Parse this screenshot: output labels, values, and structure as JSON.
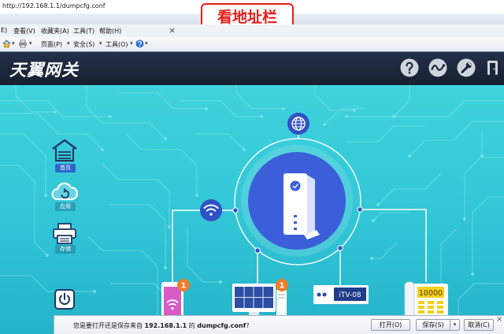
{
  "address_bar": {
    "url": "http://192.168.1.1/dumpcfg.conf"
  },
  "annotation": {
    "text": "看地址栏",
    "color": "#e3201b"
  },
  "menu_bar": {
    "items": [
      "E)",
      "查看(V)",
      "收藏夹(A)",
      "工具(T)",
      "帮助(H)"
    ],
    "close_glyph": "×"
  },
  "command_bar": {
    "home_icon": "home-icon",
    "print_icon": "printer-icon",
    "help_icon": "help-icon",
    "dropdown_glyph": "▾",
    "items": [
      {
        "label": "页面(P)"
      },
      {
        "label": "安全(S)"
      },
      {
        "label": "工具(O)"
      }
    ]
  },
  "header": {
    "logo": "天翼网关",
    "background": "#1b2738",
    "icons": [
      "help-icon",
      "network-status-icon",
      "wrench-icon",
      "logout-icon"
    ]
  },
  "sidebar": {
    "active_color": "#2f66c9",
    "items": [
      {
        "label": "首页",
        "icon": "home-icon",
        "active": true
      },
      {
        "label": "应用",
        "icon": "cloud-app-icon",
        "active": false
      },
      {
        "label": "存储",
        "icon": "storage-icon",
        "active": false
      }
    ],
    "power_icon": "power-icon"
  },
  "topology": {
    "accent": "#3a5ed8",
    "internet_icon": "globe-icon",
    "gateway_icon": "router-icon",
    "wifi_icon": "wifi-icon",
    "devices": [
      {
        "icon": "wifi-phone-icon",
        "badge": "1"
      },
      {
        "icon": "computer-icon",
        "badge": "1"
      },
      {
        "icon": "set-top-box-icon",
        "label": "iTV-08"
      },
      {
        "icon": "landline-phone-icon",
        "label": "10000"
      }
    ]
  },
  "download_bar": {
    "prompt_prefix": "您是要打开还是保存来自",
    "host": "192.168.1.1",
    "prompt_middle": "的",
    "filename": "dumpcfg.conf",
    "prompt_suffix": "?",
    "open_label": "打开(O)",
    "save_label": "保存(S)",
    "cancel_label": "取消(C)",
    "dropdown_glyph": "▾",
    "close_glyph": "×"
  }
}
